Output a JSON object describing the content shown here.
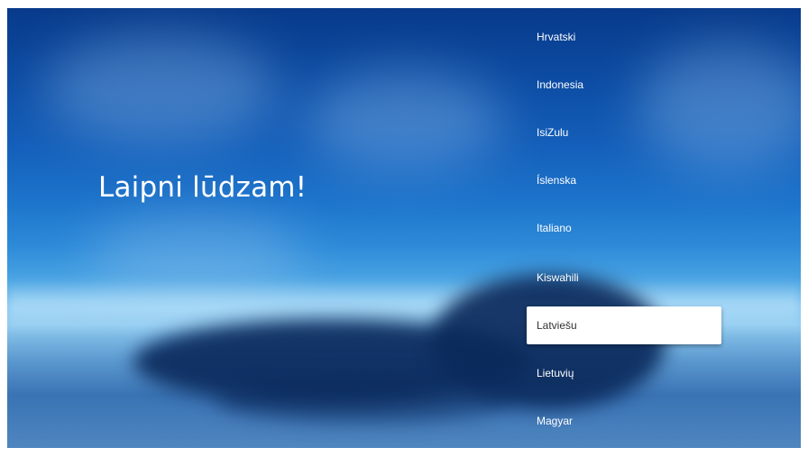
{
  "welcome": {
    "title": "Laipni lūdzam!"
  },
  "languages": {
    "items": [
      {
        "label": "Hrvatski",
        "selected": false
      },
      {
        "label": "Indonesia",
        "selected": false
      },
      {
        "label": "IsiZulu",
        "selected": false
      },
      {
        "label": "Íslenska",
        "selected": false
      },
      {
        "label": "Italiano",
        "selected": false
      },
      {
        "label": "Kiswahili",
        "selected": false
      },
      {
        "label": "Latviešu",
        "selected": true
      },
      {
        "label": "Lietuvių",
        "selected": false
      },
      {
        "label": "Magyar",
        "selected": false
      }
    ]
  },
  "colors": {
    "text": "#ffffff",
    "selected_background": "#ffffff",
    "selected_text": "#333333"
  }
}
